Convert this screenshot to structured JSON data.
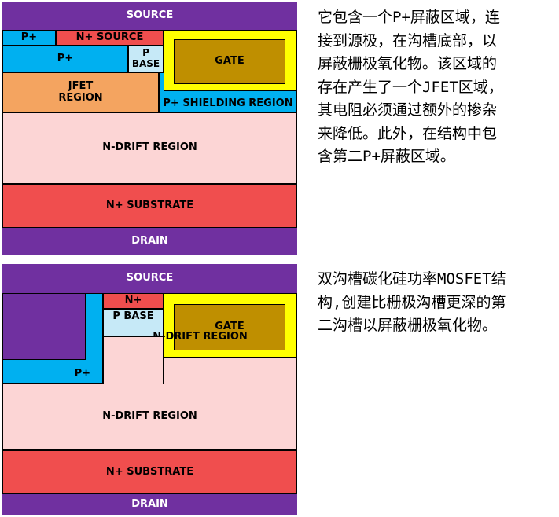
{
  "diagram1": {
    "source": "SOURCE",
    "p_plus_top": "P+",
    "n_plus_source": "N+ SOURCE",
    "p_plus_left": "P+",
    "p_base": "P\nBASE",
    "gate": "GATE",
    "jfet": "JFET\nREGION",
    "p_shielding": "P+ SHIELDING REGION",
    "n_drift": "N-DRIFT REGION",
    "n_substrate": "N+ SUBSTRATE",
    "drain": "DRAIN"
  },
  "diagram2": {
    "source": "SOURCE",
    "n_plus": "N+",
    "p_base": "P BASE",
    "gate": "GATE",
    "p_plus": "P+",
    "n_drift": "N-DRIFT REGION",
    "n_substrate": "N+ SUBSTRATE",
    "drain": "DRAIN"
  },
  "caption1": "它包含一个P+屏蔽区域，连\n接到源极，在沟槽底部，以\n屏蔽栅极氧化物。该区域的\n存在产生了一个JFET区域，\n其电阻必须通过额外的掺杂\n来降低。此外，在结构中包\n含第二P+屏蔽区域。",
  "caption2": "双沟槽碳化硅功率MOSFET结\n构,创建比栅极沟槽更深的第\n二沟槽以屏蔽栅极氧化物。",
  "colors": {
    "source_purple": "#7030a0",
    "p_plus_blue": "#00b0f0",
    "n_plus_red": "#f04e4e",
    "p_base_lightblue": "#c6e9f7",
    "gate_gold": "#bf8f00",
    "gate_oxide_yellow": "#ffff00",
    "jfet_orange": "#f4a460",
    "n_drift_pink": "#fcd5d5",
    "n_substrate_red": "#f04e4e",
    "drain_purple": "#7030a0"
  }
}
